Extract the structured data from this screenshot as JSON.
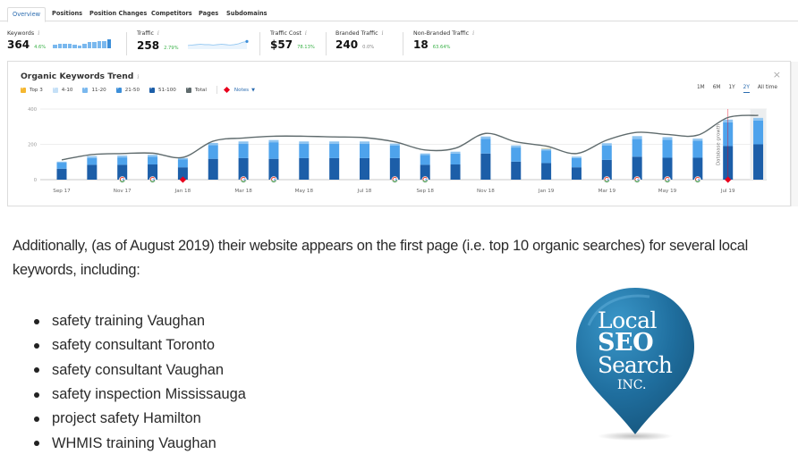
{
  "tabs": [
    {
      "label": "Overview",
      "active": true
    },
    {
      "label": "Positions",
      "active": false
    },
    {
      "label": "Position Changes",
      "active": false
    },
    {
      "label": "Competitors",
      "active": false
    },
    {
      "label": "Pages",
      "active": false
    },
    {
      "label": "Subdomains",
      "active": false
    }
  ],
  "metrics": [
    {
      "label": "Keywords",
      "value": "364",
      "change": "4.6%",
      "change_color": "#3cb24a",
      "spark": "bars"
    },
    {
      "label": "Traffic",
      "value": "258",
      "change": "2.79%",
      "change_color": "#3cb24a",
      "spark": "line"
    },
    {
      "label": "Traffic Cost",
      "value": "$57",
      "change": "78.13%",
      "change_color": "#3cb24a"
    },
    {
      "label": "Branded Traffic",
      "value": "240",
      "change": "0.0%",
      "change_color": "#888888"
    },
    {
      "label": "Non-Branded Traffic",
      "value": "18",
      "change": "63.64%",
      "change_color": "#3cb24a"
    }
  ],
  "info_glyph": "i",
  "keywords_sparkline": [
    0.45,
    0.5,
    0.55,
    0.5,
    0.45,
    0.35,
    0.55,
    0.75,
    0.75,
    0.8,
    0.85,
    1.0
  ],
  "traffic_sparkline": [
    0.35,
    0.4,
    0.45,
    0.5,
    0.45,
    0.45,
    0.4,
    0.45,
    0.5,
    0.45,
    0.4,
    0.45,
    0.55,
    0.75,
    0.85
  ],
  "panel": {
    "title": "Organic Keywords Trend",
    "close_icon": "×",
    "legend": [
      {
        "label": "Top 3",
        "color": "#f5b731"
      },
      {
        "label": "4-10",
        "color": "#c5e0f7"
      },
      {
        "label": "11-20",
        "color": "#7ab8ee"
      },
      {
        "label": "21-50",
        "color": "#3d8fd9"
      },
      {
        "label": "51-100",
        "color": "#1c5ea8"
      },
      {
        "label": "Total",
        "color": "#5f6b6d"
      }
    ],
    "notes_label": "Notes",
    "notes_color": "#e8001c",
    "ranges": [
      {
        "label": "1M",
        "active": false
      },
      {
        "label": "6M",
        "active": false
      },
      {
        "label": "1Y",
        "active": false
      },
      {
        "label": "2Y",
        "active": true
      },
      {
        "label": "All time",
        "active": false
      }
    ]
  },
  "chart_data": {
    "type": "bar",
    "title": "Organic Keywords Trend",
    "xlabel": "",
    "ylabel": "",
    "ylim": [
      0,
      400
    ],
    "yticks": [
      0,
      200,
      400
    ],
    "grid": true,
    "legend_position": "top-left",
    "categories": [
      "Sep 17",
      "Oct 17",
      "Nov 17",
      "Dec 17",
      "Jan 18",
      "Feb 18",
      "Mar 18",
      "Apr 18",
      "May 18",
      "Jun 18",
      "Jul 18",
      "Aug 18",
      "Sep 18",
      "Oct 18",
      "Nov 18",
      "Dec 18",
      "Jan 19",
      "Feb 19",
      "Mar 19",
      "Apr 19",
      "May 19",
      "Jun 19",
      "Jul 19",
      "Aug 19"
    ],
    "xtick_labels": [
      "Sep 17",
      "Nov 17",
      "Jan 18",
      "Mar 18",
      "May 18",
      "Jul 18",
      "Sep 18",
      "Nov 18",
      "Jan 19",
      "Mar 19",
      "May 19",
      "Jul 19"
    ],
    "series": [
      {
        "name": "51-100",
        "color": "#1c5ea8",
        "values": [
          62,
          84,
          84,
          86,
          70,
          118,
          122,
          118,
          122,
          122,
          122,
          122,
          84,
          86,
          148,
          102,
          94,
          70,
          112,
          130,
          124,
          124,
          190,
          200
        ]
      },
      {
        "name": "21-50",
        "color": "#4ea3ec",
        "values": [
          34,
          38,
          42,
          44,
          44,
          78,
          82,
          94,
          82,
          82,
          82,
          72,
          56,
          62,
          84,
          80,
          72,
          52,
          82,
          100,
          102,
          96,
          135,
          135
        ]
      },
      {
        "name": "11-20",
        "color": "#8cc3f0",
        "values": [
          6,
          10,
          10,
          10,
          8,
          12,
          12,
          12,
          12,
          12,
          12,
          10,
          8,
          10,
          12,
          12,
          8,
          8,
          12,
          16,
          14,
          12,
          14,
          14
        ]
      },
      {
        "name": "4-10",
        "color": "#c5e0f7",
        "values": [
          0,
          2,
          2,
          2,
          2,
          0,
          2,
          2,
          2,
          2,
          2,
          2,
          2,
          2,
          2,
          0,
          2,
          2,
          2,
          2,
          2,
          2,
          2,
          2
        ]
      },
      {
        "name": "Top 3",
        "color": "#f5b731",
        "values": [
          0,
          0,
          0,
          0,
          0,
          0,
          0,
          0,
          0,
          0,
          0,
          0,
          0,
          0,
          0,
          0,
          2,
          0,
          0,
          0,
          0,
          0,
          0,
          0
        ]
      }
    ],
    "total_line": {
      "name": "Total",
      "color": "#5f6b6d",
      "values": [
        112,
        142,
        148,
        150,
        126,
        218,
        236,
        246,
        246,
        242,
        238,
        214,
        168,
        178,
        262,
        214,
        190,
        148,
        224,
        268,
        256,
        252,
        352,
        364
      ]
    },
    "markers": [
      {
        "index": 2,
        "type": "google"
      },
      {
        "index": 3,
        "type": "google"
      },
      {
        "index": 4,
        "type": "note"
      },
      {
        "index": 6,
        "type": "google"
      },
      {
        "index": 7,
        "type": "google"
      },
      {
        "index": 11,
        "type": "google"
      },
      {
        "index": 12,
        "type": "google"
      },
      {
        "index": 18,
        "type": "google"
      },
      {
        "index": 19,
        "type": "google"
      },
      {
        "index": 20,
        "type": "google"
      },
      {
        "index": 21,
        "type": "google"
      },
      {
        "index": 22,
        "type": "note"
      }
    ],
    "annotations": [
      {
        "index": 22,
        "text": "Database growth"
      }
    ],
    "highlighted_index": 23
  },
  "article": {
    "paragraph": "Additionally, (as of August 2019) their website appears on the first page (i.e. top 10 organic searches) for several local keywords, including:",
    "keywords": [
      "safety training Vaughan",
      "safety consultant Toronto",
      "safety consultant Vaughan",
      "safety inspection Mississauga",
      "project safety Hamilton",
      "WHMIS training Vaughan"
    ]
  },
  "logo": {
    "line1": "Local",
    "line2": "SEO",
    "line3": "Search",
    "line4": "INC.",
    "color": "#1f6e9e"
  }
}
